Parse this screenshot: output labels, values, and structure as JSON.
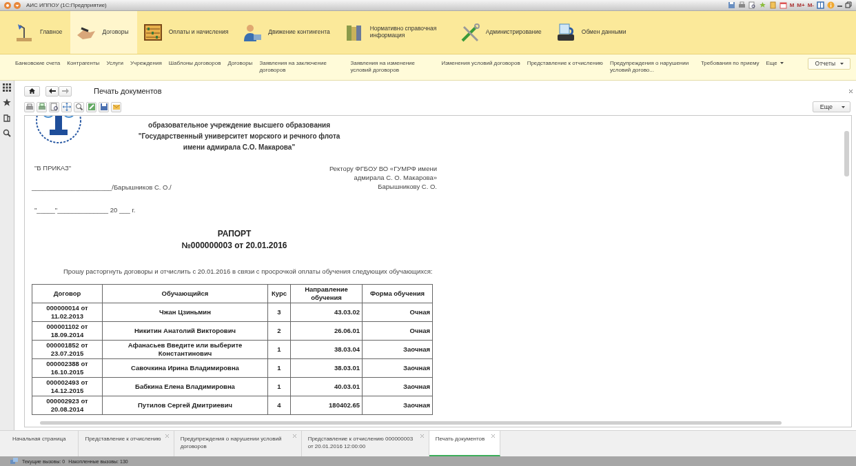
{
  "window": {
    "title": "АИС ИППОУ (1С:Предприятие)",
    "memory_buttons": [
      "M",
      "M+",
      "M-"
    ]
  },
  "sections": [
    {
      "label": "Главное",
      "selected": false
    },
    {
      "label": "Договоры",
      "selected": true
    },
    {
      "label": "Оплаты и начисления",
      "selected": false
    },
    {
      "label": "Движение контингента",
      "selected": false
    },
    {
      "label": "Нормативно справочная информация",
      "selected": false
    },
    {
      "label": "Администрирование",
      "selected": false
    },
    {
      "label": "Обмен данными",
      "selected": false
    }
  ],
  "nav_links": [
    "Банковские счета",
    "Контрагенты",
    "Услуги",
    "Учреждения",
    "Шаблоны договоров",
    "Договоры",
    "Заявления на заключение договоров",
    "Заявления на изменение условий договоров",
    "Изменения условий договоров",
    "Представление к отчислению",
    "Предупреждения о нарушении условий догово...",
    "Требования по приему"
  ],
  "nav_more": "Еще",
  "reports": "Отчеты",
  "page": {
    "title": "Печать документов",
    "more": "Еще"
  },
  "document": {
    "header_lines": [
      "образовательное учреждение высшего образования",
      "\"Государственный университет морского и речного флота",
      "имени адмирала С.О. Макарова\""
    ],
    "order_label": "\"В ПРИКАЗ\"",
    "addressee_lines": [
      "Ректору ФГБОУ ВО «ГУМРФ имени",
      "адмирала С. О. Макарова»",
      "Барышникову С. О."
    ],
    "signature": "______________________/Барышников С. О./",
    "date_line": "\"_____\"______________ 20 ___ г.",
    "title": "РАПОРТ",
    "number": "№000000003 от 20.01.2016",
    "body": "Прошу расторгнуть договоры и отчислить с 20.01.2016 в связи с просрочкой оплаты обучения следующих обучающихся:",
    "table": {
      "columns": [
        "Договор",
        "Обучающийся",
        "Курс",
        "Направление обучения",
        "Форма обучения"
      ],
      "rows": [
        [
          "000000014 от 11.02.2013",
          "Чжан Цзиньмин",
          "3",
          "43.03.02",
          "Очная"
        ],
        [
          "000001102 от 18.09.2014",
          "Никитин Анатолий Викторович",
          "2",
          "26.06.01",
          "Очная"
        ],
        [
          "000001852 от 23.07.2015",
          "Афанасьев Введите или выберите Константинович",
          "1",
          "38.03.04",
          "Заочная"
        ],
        [
          "000002388 от 16.10.2015",
          "Савочкина Ирина Владимировна",
          "1",
          "38.03.01",
          "Заочная"
        ],
        [
          "000002493 от 14.12.2015",
          "Бабкина Елена Владимировна",
          "1",
          "40.03.01",
          "Заочная"
        ],
        [
          "000002923 от 20.08.2014",
          "Путилов Сергей Дмитриевич",
          "4",
          "180402.65",
          "Заочная"
        ]
      ]
    }
  },
  "open_tabs": [
    {
      "label": "Начальная страница",
      "selected": false,
      "closable": false
    },
    {
      "label": "Представление к отчислению",
      "selected": false,
      "closable": true
    },
    {
      "label": "Предупреждения о нарушении условий договоров",
      "selected": false,
      "closable": true
    },
    {
      "label": "Представление к отчислению 000000003 от 20.01.2016 12:00:00",
      "selected": false,
      "closable": true
    },
    {
      "label": "Печать документов",
      "selected": true,
      "closable": true
    }
  ],
  "status_bar": {
    "current_calls": "Текущие вызовы: 0",
    "total_calls": "Накопленные вызовы: 130"
  }
}
